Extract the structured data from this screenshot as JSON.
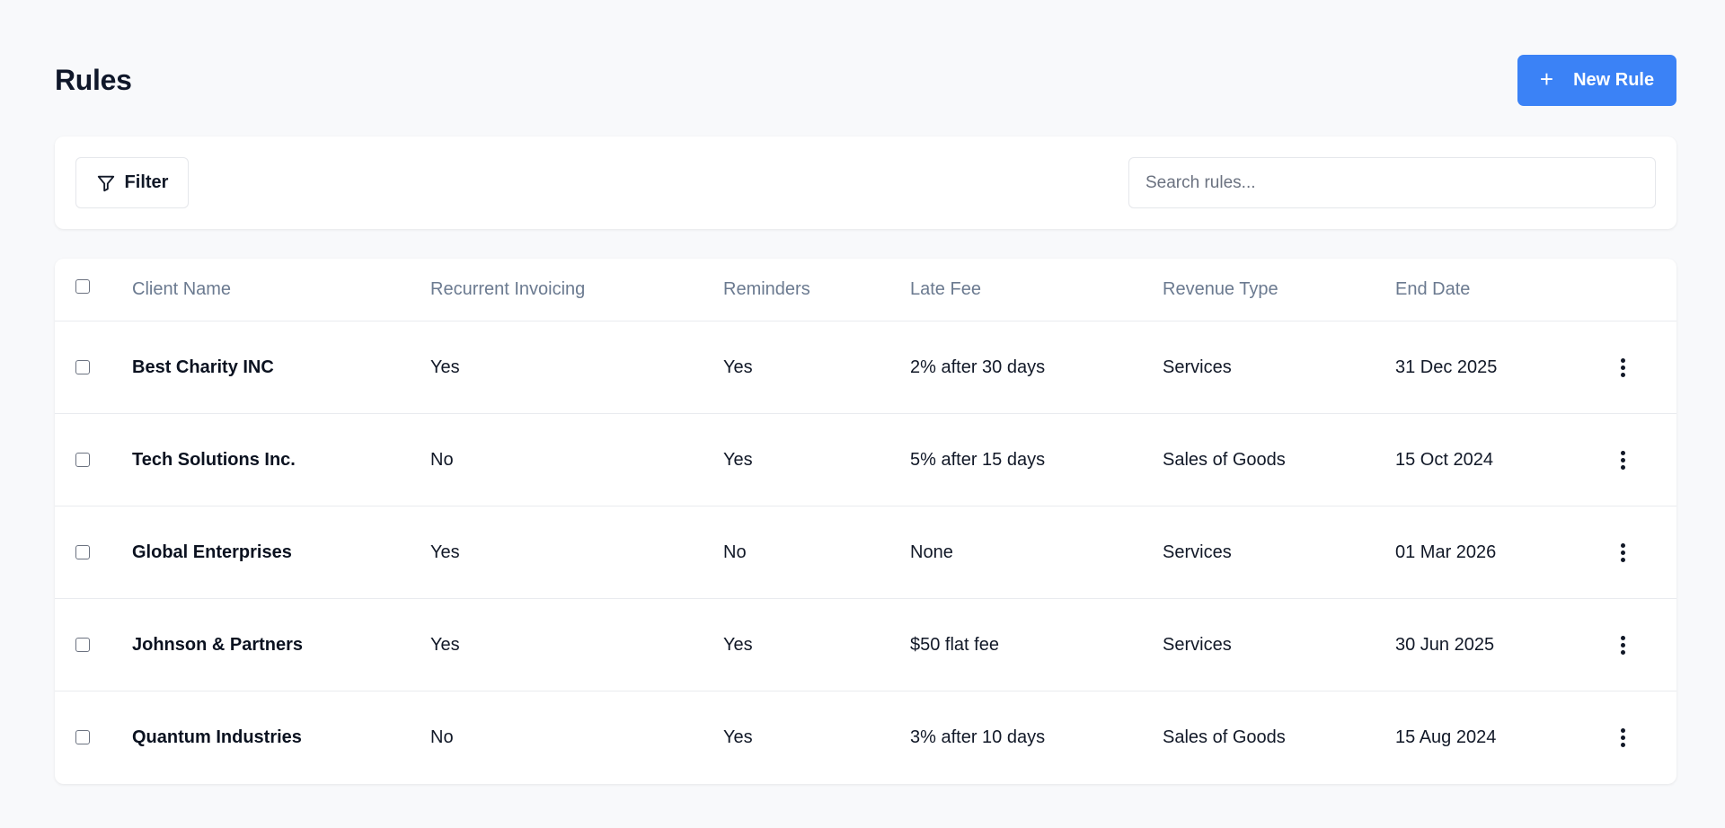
{
  "header": {
    "title": "Rules",
    "new_rule_label": "New Rule",
    "plus_icon": "+"
  },
  "toolbar": {
    "filter_label": "Filter",
    "search_placeholder": "Search rules..."
  },
  "table": {
    "columns": [
      "Client Name",
      "Recurrent Invoicing",
      "Reminders",
      "Late Fee",
      "Revenue Type",
      "End Date"
    ],
    "rows": [
      {
        "client": "Best Charity INC",
        "recurrent": "Yes",
        "reminders": "Yes",
        "late_fee": "2% after 30 days",
        "revenue": "Services",
        "end_date": "31 Dec 2025"
      },
      {
        "client": "Tech Solutions Inc.",
        "recurrent": "No",
        "reminders": "Yes",
        "late_fee": "5% after 15 days",
        "revenue": "Sales of Goods",
        "end_date": "15 Oct 2024"
      },
      {
        "client": "Global Enterprises",
        "recurrent": "Yes",
        "reminders": "No",
        "late_fee": "None",
        "revenue": "Services",
        "end_date": "01 Mar 2026"
      },
      {
        "client": "Johnson & Partners",
        "recurrent": "Yes",
        "reminders": "Yes",
        "late_fee": "$50 flat fee",
        "revenue": "Services",
        "end_date": "30 Jun 2025"
      },
      {
        "client": "Quantum Industries",
        "recurrent": "No",
        "reminders": "Yes",
        "late_fee": "3% after 10 days",
        "revenue": "Sales of Goods",
        "end_date": "15 Aug 2024"
      }
    ]
  },
  "colors": {
    "accent": "#3b82f6",
    "background": "#f8f9fb",
    "header_text": "#6b7a90"
  },
  "icons": {
    "plus": "plus-icon",
    "filter": "filter-icon",
    "row_actions": "kebab-menu-icon"
  }
}
